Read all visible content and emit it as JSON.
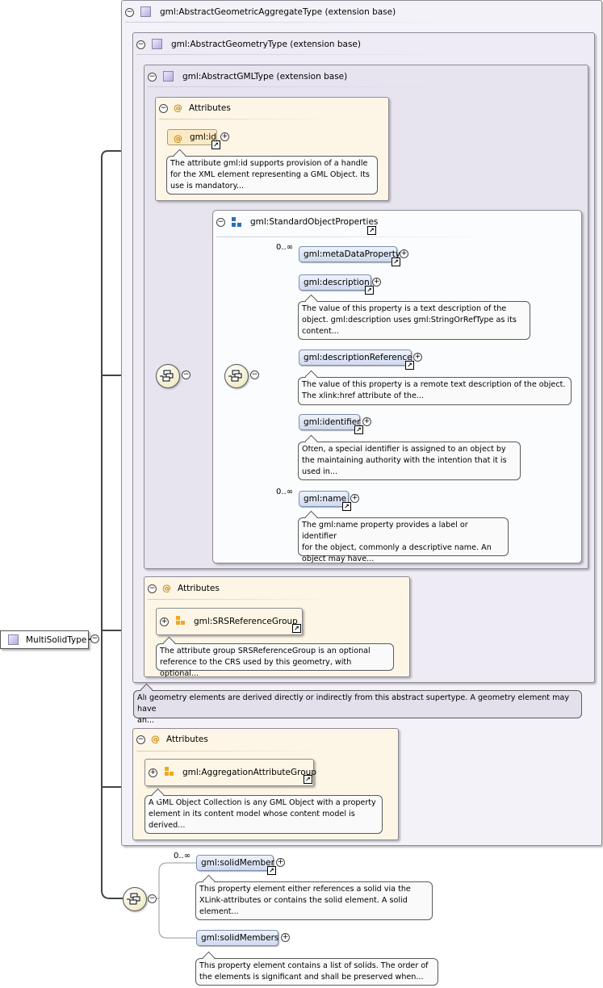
{
  "ext1": {
    "title": "gml:AbstractGeometricAggregateType (extension base)"
  },
  "ext2": {
    "title": "gml:AbstractGeometryType (extension base)"
  },
  "ext3": {
    "title": "gml:AbstractGMLType (extension base)"
  },
  "attrs1": {
    "title": "Attributes",
    "item": "gml:id",
    "doc": [
      "The attribute gml:id supports provision of a handle",
      "for the XML element representing a GML Object. Its",
      "use is mandatory..."
    ]
  },
  "sop": {
    "title": "gml:StandardObjectProperties",
    "elements": [
      {
        "label": "gml:metaDataProperty",
        "occurs": "0..∞",
        "doc": []
      },
      {
        "label": "gml:description",
        "occurs": "",
        "doc": [
          "The value of this property is a text description of the",
          "object. gml:description uses gml:StringOrRefType as its",
          "content..."
        ]
      },
      {
        "label": "gml:descriptionReference",
        "occurs": "",
        "doc": [
          "The value of this property is a remote text description of the object.",
          "The xlink:href attribute of the..."
        ]
      },
      {
        "label": "gml:identifier",
        "occurs": "",
        "doc": [
          "Often, a special identifier is assigned to an object by",
          "the maintaining authority with the intention that it is",
          "used in..."
        ]
      },
      {
        "label": "gml:name",
        "occurs": "0..∞",
        "doc": [
          "The gml:name property provides a label or identifier",
          "for the object, commonly a descriptive name. An",
          "object may have..."
        ]
      }
    ]
  },
  "attrs2": {
    "title": "Attributes",
    "group": "gml:SRSReferenceGroup",
    "doc": [
      "The attribute group SRSReferenceGroup is an optional",
      "reference to the CRS used by this geometry, with optional..."
    ]
  },
  "geomdoc": [
    "All geometry elements are derived directly or indirectly from this abstract supertype. A geometry element may have",
    "an..."
  ],
  "attrs3": {
    "title": "Attributes",
    "group": "gml:AggregationAttributeGroup",
    "doc": [
      "A GML Object Collection is any GML Object with a property",
      "element in its content model whose content model is",
      "derived..."
    ]
  },
  "root": {
    "label": "MultiSolidType"
  },
  "members": [
    {
      "label": "gml:solidMember",
      "occurs": "0..∞",
      "doc": [
        "This property element either references a solid via the",
        "XLink-attributes or contains the solid element. A solid",
        "element..."
      ]
    },
    {
      "label": "gml:solidMembers",
      "occurs": "",
      "doc": [
        "This property element contains a list of solids. The order of",
        "the elements is significant and shall be preserved when..."
      ]
    }
  ]
}
